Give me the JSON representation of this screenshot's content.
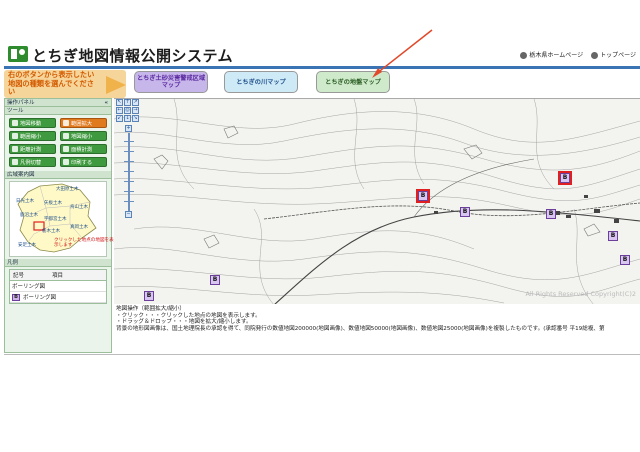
{
  "header": {
    "title": "とちぎ地図情報公開システム",
    "links": [
      "栃木県ホームページ",
      "トップページ"
    ]
  },
  "instruction": {
    "text": "右のボタンから表示したい地図の種類を選んでください"
  },
  "map_buttons": {
    "sabo": "とちぎ土砂災害警戒区域マップ",
    "kawa": "とちぎの川マップ",
    "jiban": "とちぎの地盤マップ"
  },
  "left_panel": {
    "title": "操作パネル",
    "tools_title": "ツール",
    "tools": [
      "地図移動",
      "範囲拡大",
      "範囲縮小",
      "地図縮小",
      "距離計測",
      "面積計測",
      "凡例切替",
      "印刷する"
    ],
    "guide_title": "広域案内図",
    "guide_labels": [
      "大田原土木",
      "日光土木",
      "矢板土木",
      "烏山土木",
      "鹿沼土木",
      "宇都宮土木",
      "真岡土木",
      "栃木土木",
      "安足土木"
    ],
    "guide_note": "クリックした地点の地図を表示します",
    "legend_title": "凡例",
    "legend_headers": [
      "記号",
      "項目"
    ],
    "legend_group": "ボーリング図",
    "legend_item": "ボーリング図"
  },
  "map": {
    "markers": [
      "B",
      "B",
      "B",
      "B",
      "B",
      "B",
      "B",
      "B"
    ],
    "copyright": "All Rights Reserved Copyright(C)2"
  },
  "info": {
    "lines": [
      "地図操作（範囲拡大/縮小）",
      "・クリック・・・クリックした地点の地図を表示します。",
      "・ドラッグ＆ドロップ・・・地図を拡大/縮小します。",
      "",
      "背景の地形図画像は、国土地理院長の承認を得て、同院発行の数値地図200000(地図画像)、数値地図50000(地図画像)、数値地図25000(地図画像)を複製したものです。(承認番号 平19総複、第"
    ]
  },
  "colors": {
    "accent_blue": "#3a74b4",
    "panel_green": "#3f9a3f",
    "instruction_orange": "#f6d59a",
    "marker_purple": "#d9c6f0"
  }
}
